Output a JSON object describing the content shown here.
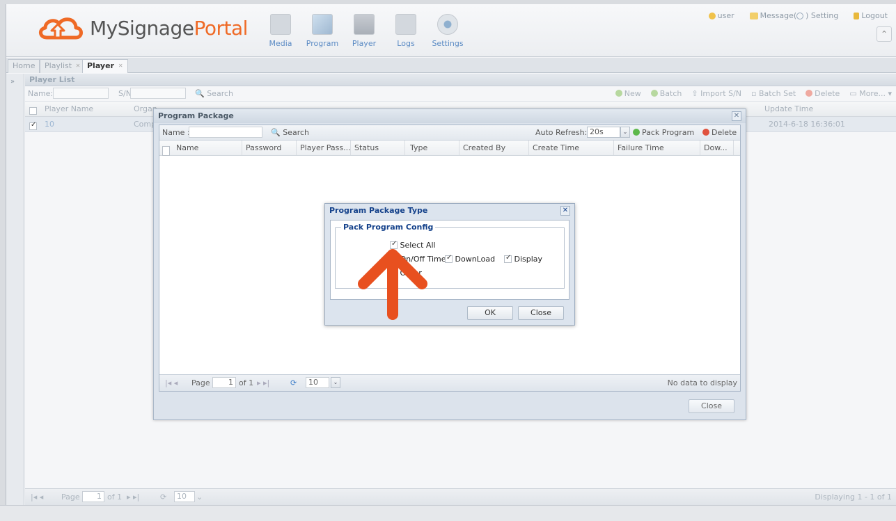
{
  "header": {
    "logo_a": "MySignage",
    "logo_b": "Portal",
    "nav": [
      {
        "label": "Media",
        "icon": "media-icon"
      },
      {
        "label": "Program",
        "icon": "program-icon"
      },
      {
        "label": "Player",
        "icon": "player-icon"
      },
      {
        "label": "Logs",
        "icon": "logs-icon"
      },
      {
        "label": "Settings",
        "icon": "settings-icon"
      }
    ],
    "user": "user",
    "message": "Message(",
    "setting": ") Setting",
    "logout": "Logout"
  },
  "tabs": {
    "home": "Home",
    "playlist": "Playlist",
    "player": "Player"
  },
  "player_list": {
    "title": "Player List",
    "name_label": "Name:",
    "sn_label": "S/N:",
    "search": "Search",
    "toolbar": {
      "new": "New",
      "batch": "Batch",
      "import": "Import S/N",
      "batch_set": "Batch Set",
      "delete": "Delete",
      "more": "More..."
    },
    "columns": {
      "player_name": "Player Name",
      "organ": "Organ",
      "update_time": "Update Time"
    },
    "row": {
      "name": "10",
      "organ": "Comp",
      "update_time": "2014-6-18 16:36:01"
    },
    "footer": {
      "page": "Page",
      "page_value": "1",
      "of": "of 1",
      "page_size": "10",
      "status": "Displaying 1 - 1 of 1"
    }
  },
  "package": {
    "title": "Program Package",
    "name_label": "Name :",
    "search": "Search",
    "auto_refresh_label": "Auto Refresh:",
    "auto_refresh_value": "20s",
    "pack_program": "Pack Program",
    "delete": "Delete",
    "columns": [
      "Name",
      "Password",
      "Player Pass...",
      "Status",
      "Type",
      "Created By",
      "Create Time",
      "Failure Time",
      "Dow..."
    ],
    "footer": {
      "page": "Page",
      "page_value": "1",
      "of": "of 1",
      "page_size": "10",
      "status": "No data to display"
    },
    "close": "Close"
  },
  "dialog": {
    "title": "Program Package Type",
    "legend": "Pack Program Config",
    "select_all": "Select All",
    "on_off_timer": "On/Off Timer",
    "download": "DownLoad",
    "display": "Display",
    "other": "Other",
    "ok": "OK",
    "close": "Close"
  },
  "colors": {
    "accent": "#ef6a26",
    "brand_blue": "#15428b",
    "arrow": "#e8501f"
  }
}
